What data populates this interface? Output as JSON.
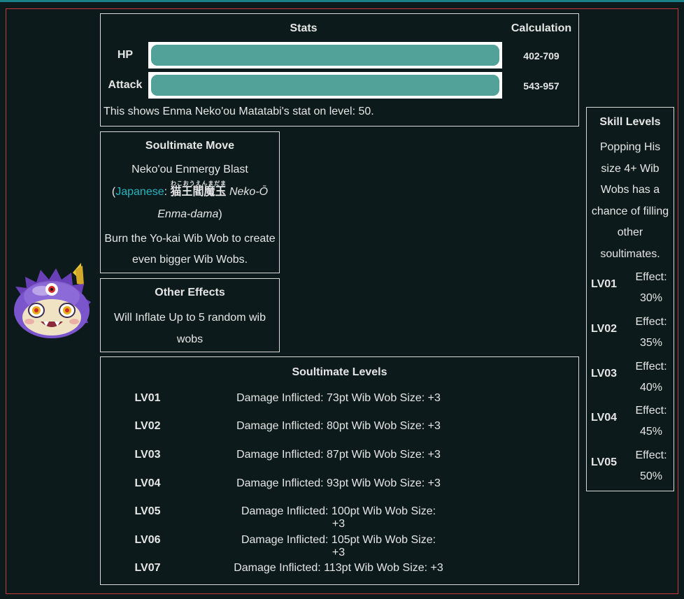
{
  "stats": {
    "header": "Stats",
    "calc_header": "Calculation",
    "hp": {
      "label": "HP",
      "value": "402-709",
      "fill": 1.0
    },
    "attack": {
      "label": "Attack",
      "value": "543-957",
      "fill": 1.0
    },
    "note": "This shows Enma Neko'ou Matatabi's stat on level: 50."
  },
  "soultimate_move": {
    "title": "Soultimate Move",
    "name": "Neko'ou Enmergy Blast",
    "jp_open": "(",
    "jp_link": "Japanese",
    "jp_colon": ": ",
    "jp_kanji": "猫王閻魔玉",
    "jp_ruby": "わこおうえんまだま",
    "jp_romaji": "Neko-Ō Enma-dama",
    "jp_close": ")",
    "description": "Burn the Yo-kai Wib Wob to create even bigger Wib Wobs."
  },
  "other_effects": {
    "title": "Other Effects",
    "description": "Will Inflate Up to 5 random wib wobs"
  },
  "soultimate_levels": {
    "title": "Soultimate Levels",
    "rows": [
      {
        "level": "LV01",
        "text": "Damage Inflicted: 73pt Wib Wob Size: +3"
      },
      {
        "level": "LV02",
        "text": "Damage Inflicted: 80pt Wib Wob Size: +3"
      },
      {
        "level": "LV03",
        "text": "Damage Inflicted: 87pt Wib Wob Size: +3"
      },
      {
        "level": "LV04",
        "text": "Damage Inflicted: 93pt Wib Wob Size: +3"
      },
      {
        "level": "LV05",
        "text": "Damage Inflicted: 100pt Wib Wob Size: +3"
      },
      {
        "level": "LV06",
        "text": "Damage Inflicted: 105pt Wib Wob Size: +3"
      },
      {
        "level": "LV07",
        "text": "Damage Inflicted: 113pt Wib Wob Size: +3"
      }
    ]
  },
  "skill_levels": {
    "title": "Skill Levels",
    "description": "Popping His size 4+ Wib Wobs has a chance of filling other soultimates.",
    "effect_label": "Effect:",
    "rows": [
      {
        "level": "LV01",
        "value": "30%"
      },
      {
        "level": "LV02",
        "value": "35%"
      },
      {
        "level": "LV03",
        "value": "40%"
      },
      {
        "level": "LV04",
        "value": "45%"
      },
      {
        "level": "LV05",
        "value": "50%"
      }
    ]
  },
  "colors": {
    "background": "#0d1a1b",
    "bar": "#52a29a",
    "link": "#24b5c0",
    "frame": "#c43a3a",
    "character_purple": "#7a55cc"
  },
  "icons": {
    "character": "enma-nekoou-matatabi-icon"
  }
}
